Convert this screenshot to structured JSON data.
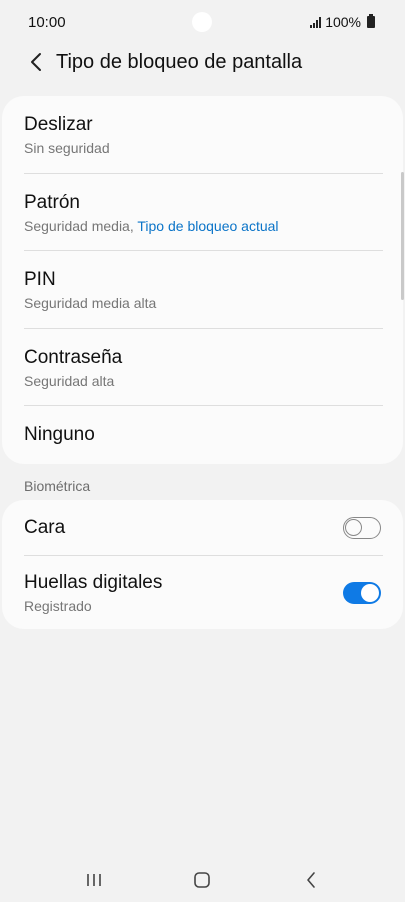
{
  "status_bar": {
    "time": "10:00",
    "battery": "100%"
  },
  "header": {
    "title": "Tipo de bloqueo de pantalla",
    "back_icon": "chevron-left-icon"
  },
  "lock_types": [
    {
      "title": "Deslizar",
      "subtitle": "Sin seguridad"
    },
    {
      "title": "Patrón",
      "subtitle": "Seguridad media, ",
      "subtitle_accent": "Tipo de bloqueo actual"
    },
    {
      "title": "PIN",
      "subtitle": "Seguridad media alta"
    },
    {
      "title": "Contraseña",
      "subtitle": "Seguridad alta"
    },
    {
      "title": "Ninguno"
    }
  ],
  "biometrics": {
    "section_title": "Biométrica",
    "items": [
      {
        "title": "Cara",
        "enabled": false
      },
      {
        "title": "Huellas digitales",
        "subtitle": "Registrado",
        "enabled": true
      }
    ]
  },
  "colors": {
    "accent": "#0b74c8",
    "toggle_on": "#0f7ae5",
    "background": "#f2f2f2"
  },
  "nav_bar": {
    "icons": [
      "recents-icon",
      "home-icon",
      "back-icon"
    ]
  }
}
